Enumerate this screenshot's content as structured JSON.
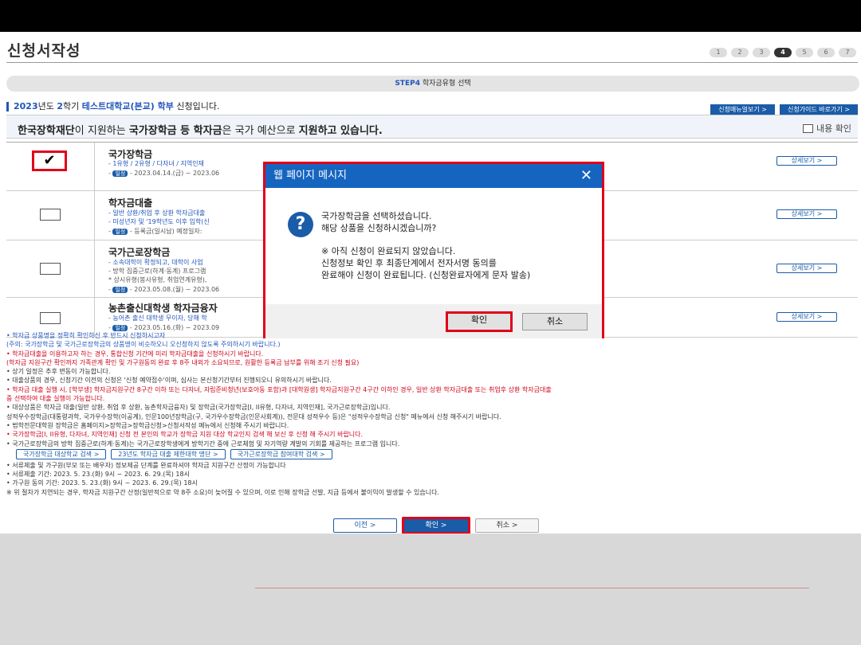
{
  "page": {
    "title": "신청서작성",
    "steps": [
      "1",
      "2",
      "3",
      "4",
      "5",
      "6",
      "7"
    ],
    "step_bar": {
      "step": "STEP4",
      "label": "학자금유형 선택"
    },
    "info": {
      "year": "2023",
      "y_txt": "년도 ",
      "semester": "2",
      "s_txt": "학기 ",
      "school": "테스트대학교(본교) 학부",
      "suffix": " 신청입니다."
    },
    "top_buttons": [
      "신청매뉴얼보기 >",
      "신청가이드 바로가기 >"
    ],
    "banner": {
      "p1": "한국장학재단",
      "p2": "이 지원하는 ",
      "p3": "국가장학금 등 학자금",
      "p4": "은 국가 예산으로 ",
      "p5": "지원하고 있습니다.",
      "confirm": "내용 확인"
    },
    "rows": [
      {
        "title": "국가장학금",
        "l1": "- 1유형 / 2유형 / 다자녀 / 지역인재",
        "badge": "일정",
        "l2": "- 2023.04.14.(금) ~ 2023.06",
        "detail": "상세보기 >",
        "checked": "✔"
      },
      {
        "title": "학자금대출",
        "l1": "- 일반 상환/취업 후 상환 학자금대출",
        "l1b": "- 미성년자 및 '19학년도 이후 입학(신",
        "badge": "일정",
        "l2": "- 등록금(일시납) 예정일자:",
        "detail": "상세보기 >"
      },
      {
        "title": "국가근로장학금",
        "l1": "- 소속대학이 확정되고, 대학이 사업",
        "l1b": "- 방학 집중근로(하계·동계) 프로그램",
        "l1c": "* 상시유형(봉사유형, 취업연계유형),",
        "badge": "일정",
        "l2": "- 2023.05.08.(월) ~ 2023.06",
        "detail": "상세보기 >"
      },
      {
        "title": "농촌출신대학생 학자금융자",
        "l1": "- 농어촌 출신 대학생 무이자, 당해 학",
        "badge": "일정",
        "l2": "- 2023.05.16.(화) ~ 2023.09",
        "detail": "상세보기 >"
      }
    ],
    "notes": [
      {
        "c": "blue",
        "t": "• 학자금 상품명을 정확히 확인하신 후 반드시 신청하시고자"
      },
      {
        "c": "blue",
        "t": "   (주의: 국가장학금 및 국가근로장학금의 상품명이 비슷하오니 오신청하지 않도록 주의하시기 바랍니다.)"
      },
      {
        "c": "red",
        "t": "• 학자금대출을 이용하고자 하는 경우, 통합신청 기간에 미리 학자금대출을 신청하시기 바랍니다."
      },
      {
        "c": "red",
        "t": "   (학자금 지원구간 확인까지 가족관계 확인 및 가구원동의 완료 후 8주 내외가 소요되므로, 원활한 등록금 납부를 위해 조기 신청 필요)"
      },
      {
        "c": "dark",
        "t": "• 상기 일정은 추후 변동이 가능합니다."
      },
      {
        "c": "dark",
        "t": "• 대출상품의 경우, 신청기간 이전의 신청은 '신청 예약접수'이며, 심사는 본신청기간부터 진행되오니 유의하시기 바랍니다."
      },
      {
        "c": "red",
        "t": "• 학자금 대출 실행 시, [학부생] 학자금지원구간 8구간 이하 또는 다자녀, 자립준비청년(보호아동 포함)과 [대학원생] 학자금지원구간 4구간 이하인 경우, 일반 상환 학자금대출 또는 취업후 상환 학자금대출"
      },
      {
        "c": "red",
        "t": "   중 선택하여 대출 실행이 가능합니다."
      },
      {
        "c": "dark",
        "t": "• 대상상품은 학자금 대출(일반 상환, 취업 후 상환, 농촌학자금융자) 및 장학금(국가장학금[I, II유형, 다자녀, 지역인재], 국가근로장학금)입니다."
      },
      {
        "c": "dark",
        "t": "   성적우수장학금(대통령과학, 국가우수장학(이공계), 인문100년장학금(구, 국가우수장학금(인문사회계)), 전문대 성적우수 등)은 \"성적우수장학금 신청\" 메뉴에서 신청 해주시기 바랍니다."
      },
      {
        "c": "dark",
        "t": "• 법학전문대학원 장학금은 홈페이지>장학금>장학금신청>신청서작성 메뉴에서 신청해 주시기 바랍니다."
      },
      {
        "c": "red",
        "t": "• 국가장학금[I, II유형, 다자녀, 지역인재] 신청 전 본인의 학교가 장학금 지원 대상 학교인지 검색 해 보신 후 신청 해 주시기 바랍니다."
      },
      {
        "c": "dark",
        "t": "• 국가근로장학금의 방학 집중근로(하계·동계)는 국가근로장학생에게 방학기간 중에 근로체험 및 자기역량 계발의 기회를 제공하는 프로그램 입니다."
      }
    ],
    "links": [
      "국가장학금 대상학교 검색 >",
      "23년도 학자금 대출 제한대학 명단 >",
      "국가근로장학금 참여대학 검색 >"
    ],
    "notes2": [
      "• 서류제출 및 가구원(부모 또는 배우자) 정보제공 단계를 완료하셔야 학자금 지원구간 산정이 가능합니다",
      "• 서류제출 기간: 2023. 5. 23.(화) 9시 ~ 2023. 6. 29.(목) 18시",
      "• 가구원 동의 기간: 2023. 5. 23.(화) 9시 ~ 2023. 6. 29.(목) 18시",
      "   ※ 위 절차가 지연되는 경우, 학자금 지원구간 산정(일반적으로 약 8주 소요)이 늦어질 수 있으며, 이로 인해 장학금 선발, 지급 등에서 불이익이 발생할 수 있습니다."
    ],
    "nav": {
      "prev": "이전     >",
      "ok": "확인     >",
      "cancel": "취소     >"
    }
  },
  "dialog": {
    "title": "웹 페이지 메시지",
    "close": "✕",
    "icon": "?",
    "line1": "국가장학금을 선택하셨습니다.",
    "line2": "해당 상품을 신청하시겠습니까?",
    "line3": "※ 아직 신청이 완료되지 않았습니다.",
    "line4": "신청정보 확인 후 최종단계에서 전자서명 동의를",
    "line5": "완료해야 신청이 완료됩니다. (신청완료자에게 문자 발송)",
    "ok": "확인",
    "cancel": "취소"
  }
}
